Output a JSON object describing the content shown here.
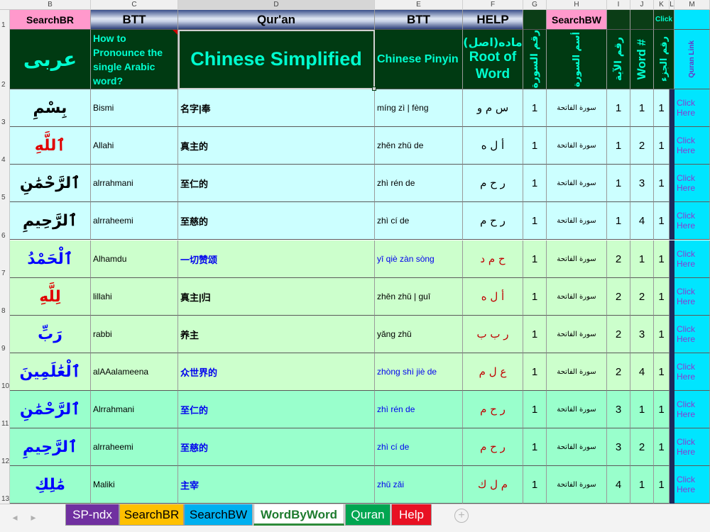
{
  "columns": [
    "B",
    "C",
    "D",
    "E",
    "F",
    "G",
    "H",
    "I",
    "J",
    "K",
    "L",
    "M"
  ],
  "row_numbers": [
    "1",
    "2",
    "3",
    "4",
    "5",
    "6",
    "7",
    "8",
    "9",
    "10",
    "11",
    "12",
    "13"
  ],
  "header_row1": {
    "b": "SearchBR",
    "c": "BTT",
    "d": "Qur'an",
    "e": "BTT",
    "f": "HELP",
    "h": "SearchBW",
    "k": "Click"
  },
  "header_row2": {
    "b": "عربى",
    "c": "How to Pronounce the single Arabic word?",
    "d": "Chinese Simplified",
    "e": "Chinese Pinyin",
    "f_arabic": "ماده(اصل)",
    "f_english": "Root of Word",
    "g": "رقم السورة",
    "h": "أسم السورة",
    "i": "رقم الآية",
    "j": "Word #",
    "k": "رقم الجزء",
    "m": "Quran Link"
  },
  "rows": [
    {
      "arabic": "بِسْمِ",
      "pron": "Bismi",
      "chinese": "名字|奉",
      "pinyin": "míng zì | fèng",
      "root": "س م و",
      "surah_no": "1",
      "surah_name": "سورة الفاتحة",
      "ayah": "1",
      "word": "1",
      "juz": "1",
      "link": "Click Here"
    },
    {
      "arabic": "ٱللَّهِ",
      "pron": "Allahi",
      "chinese": "真主的",
      "pinyin": "zhēn zhǔ de",
      "root": "أ ل ه",
      "surah_no": "1",
      "surah_name": "سورة الفاتحة",
      "ayah": "1",
      "word": "2",
      "juz": "1",
      "link": "Click Here"
    },
    {
      "arabic": "ٱلرَّحْمَٰنِ",
      "pron": "alrrahmani",
      "chinese": "至仁的",
      "pinyin": "zhì rén de",
      "root": "ر ح م",
      "surah_no": "1",
      "surah_name": "سورة الفاتحة",
      "ayah": "1",
      "word": "3",
      "juz": "1",
      "link": "Click Here"
    },
    {
      "arabic": "ٱلرَّحِيمِ",
      "pron": "alrraheemi",
      "chinese": "至慈的",
      "pinyin": "zhì cí de",
      "root": "ر ح م",
      "surah_no": "1",
      "surah_name": "سورة الفاتحة",
      "ayah": "1",
      "word": "4",
      "juz": "1",
      "link": "Click Here"
    },
    {
      "arabic": "ٱلْحَمْدُ",
      "pron": "Alhamdu",
      "chinese": "一切赞颂",
      "pinyin": "yī qiè zàn sòng",
      "root": "ح م د",
      "surah_no": "1",
      "surah_name": "سورة الفاتحة",
      "ayah": "2",
      "word": "1",
      "juz": "1",
      "link": "Click Here"
    },
    {
      "arabic": "لِلَّهِ",
      "pron": "lillahi",
      "chinese": "真主|归",
      "pinyin": "zhēn zhǔ | guī",
      "root": "أ ل ه",
      "surah_no": "1",
      "surah_name": "سورة الفاتحة",
      "ayah": "2",
      "word": "2",
      "juz": "1",
      "link": "Click Here"
    },
    {
      "arabic": "رَبِّ",
      "pron": "rabbi",
      "chinese": "养主",
      "pinyin": "yǎng zhǔ",
      "root": "ر ب ب",
      "surah_no": "1",
      "surah_name": "سورة الفاتحة",
      "ayah": "2",
      "word": "3",
      "juz": "1",
      "link": "Click Here"
    },
    {
      "arabic": "ٱلْعَٰلَمِينَ",
      "pron": "alAAalameena",
      "chinese": "众世界的",
      "pinyin": "zhòng shì jiè de",
      "root": "ع ل م",
      "surah_no": "1",
      "surah_name": "سورة الفاتحة",
      "ayah": "2",
      "word": "4",
      "juz": "1",
      "link": "Click Here"
    },
    {
      "arabic": "ٱلرَّحْمَٰنِ",
      "pron": "Alrrahmani",
      "chinese": "至仁的",
      "pinyin": "zhì rén de",
      "root": "ر ح م",
      "surah_no": "1",
      "surah_name": "سورة الفاتحة",
      "ayah": "3",
      "word": "1",
      "juz": "1",
      "link": "Click Here"
    },
    {
      "arabic": "ٱلرَّحِيمِ",
      "pron": "alrraheemi",
      "chinese": "至慈的",
      "pinyin": "zhì cí de",
      "root": "ر ح م",
      "surah_no": "1",
      "surah_name": "سورة الفاتحة",
      "ayah": "3",
      "word": "2",
      "juz": "1",
      "link": "Click Here"
    },
    {
      "arabic": "مَٰلِكِ",
      "pron": "Maliki",
      "chinese": "主宰",
      "pinyin": "zhǔ zǎi",
      "root": "م ل ك",
      "surah_no": "1",
      "surah_name": "سورة الفاتحة",
      "ayah": "4",
      "word": "1",
      "juz": "1",
      "link": "Click Here"
    }
  ],
  "tabs": [
    {
      "label": "SP-ndx",
      "bg": "#7030a0",
      "color": "#ffffff"
    },
    {
      "label": "SearchBR",
      "bg": "#ffc000",
      "color": "#000000"
    },
    {
      "label": "SearchBW",
      "bg": "#00b0f0",
      "color": "#000000"
    },
    {
      "label": "WordByWord",
      "bg": "#c6efce",
      "color": "#1e7b2e"
    },
    {
      "label": "Quran",
      "bg": "#00a651",
      "color": "#ffffff"
    },
    {
      "label": "Help",
      "bg": "#e81123",
      "color": "#ffffff"
    }
  ],
  "active_tab": "WordByWord",
  "colors": {
    "arabic_black": "#000000",
    "arabic_red": "#e00000",
    "arabic_blue": "#0000ff",
    "root_black": "#000000",
    "root_red": "#c00000",
    "text_blue": "#0000ee",
    "text_red": "#c00000"
  },
  "row_styles": [
    {
      "bg": "cyan",
      "arabic_color": "arabic_black",
      "text_color": "black",
      "root_color": "root_black"
    },
    {
      "bg": "cyan",
      "arabic_color": "arabic_red",
      "text_color": "black",
      "root_color": "root_black"
    },
    {
      "bg": "cyan",
      "arabic_color": "arabic_black",
      "text_color": "black",
      "root_color": "root_black"
    },
    {
      "bg": "cyan",
      "arabic_color": "arabic_black",
      "text_color": "black",
      "root_color": "root_black"
    },
    {
      "bg": "green",
      "arabic_color": "arabic_blue",
      "text_color": "text_blue",
      "root_color": "root_red"
    },
    {
      "bg": "green",
      "arabic_color": "arabic_red",
      "text_color": "black",
      "root_color": "root_red"
    },
    {
      "bg": "green",
      "arabic_color": "arabic_blue",
      "text_color": "black",
      "root_color": "root_red"
    },
    {
      "bg": "green",
      "arabic_color": "arabic_blue",
      "text_color": "text_blue",
      "root_color": "root_red"
    },
    {
      "bg": "teal",
      "arabic_color": "arabic_blue",
      "text_color": "text_blue",
      "root_color": "root_red"
    },
    {
      "bg": "teal",
      "arabic_color": "arabic_blue",
      "text_color": "text_blue",
      "root_color": "root_red"
    },
    {
      "bg": "teal",
      "arabic_color": "arabic_blue",
      "text_color": "text_blue",
      "root_color": "root_red"
    }
  ]
}
